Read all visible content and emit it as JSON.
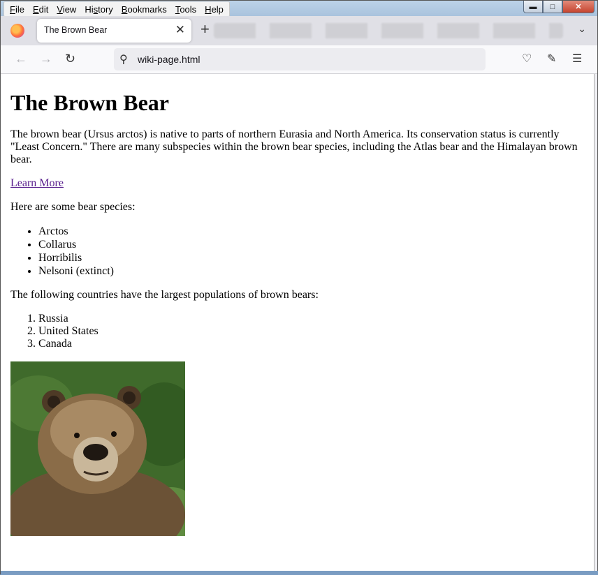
{
  "menu": [
    "File",
    "Edit",
    "View",
    "History",
    "Bookmarks",
    "Tools",
    "Help"
  ],
  "menu_underline": [
    "F",
    "E",
    "V",
    "s",
    "B",
    "T",
    "H"
  ],
  "tab": {
    "title": "The Brown Bear"
  },
  "url": "wiki-page.html",
  "page": {
    "heading": "The Brown Bear",
    "intro": "The brown bear (Ursus arctos) is native to parts of northern Eurasia and North America. Its conservation status is currently \"Least Concern.\" There are many subspecies within the brown bear species, including the Atlas bear and the Himalayan brown bear.",
    "link": "Learn More",
    "species_intro": "Here are some bear species:",
    "species": [
      "Arctos",
      "Collarus",
      "Horribilis",
      "Nelsoni (extinct)"
    ],
    "countries_intro": "The following countries have the largest populations of brown bears:",
    "countries": [
      "Russia",
      "United States",
      "Canada"
    ]
  },
  "icons": {
    "back": "back-arrow-icon",
    "forward": "forward-arrow-icon",
    "reload": "reload-icon",
    "search": "search-icon",
    "pocket": "pocket-icon",
    "extensions": "extensions-icon",
    "menu": "hamburger-menu-icon"
  }
}
